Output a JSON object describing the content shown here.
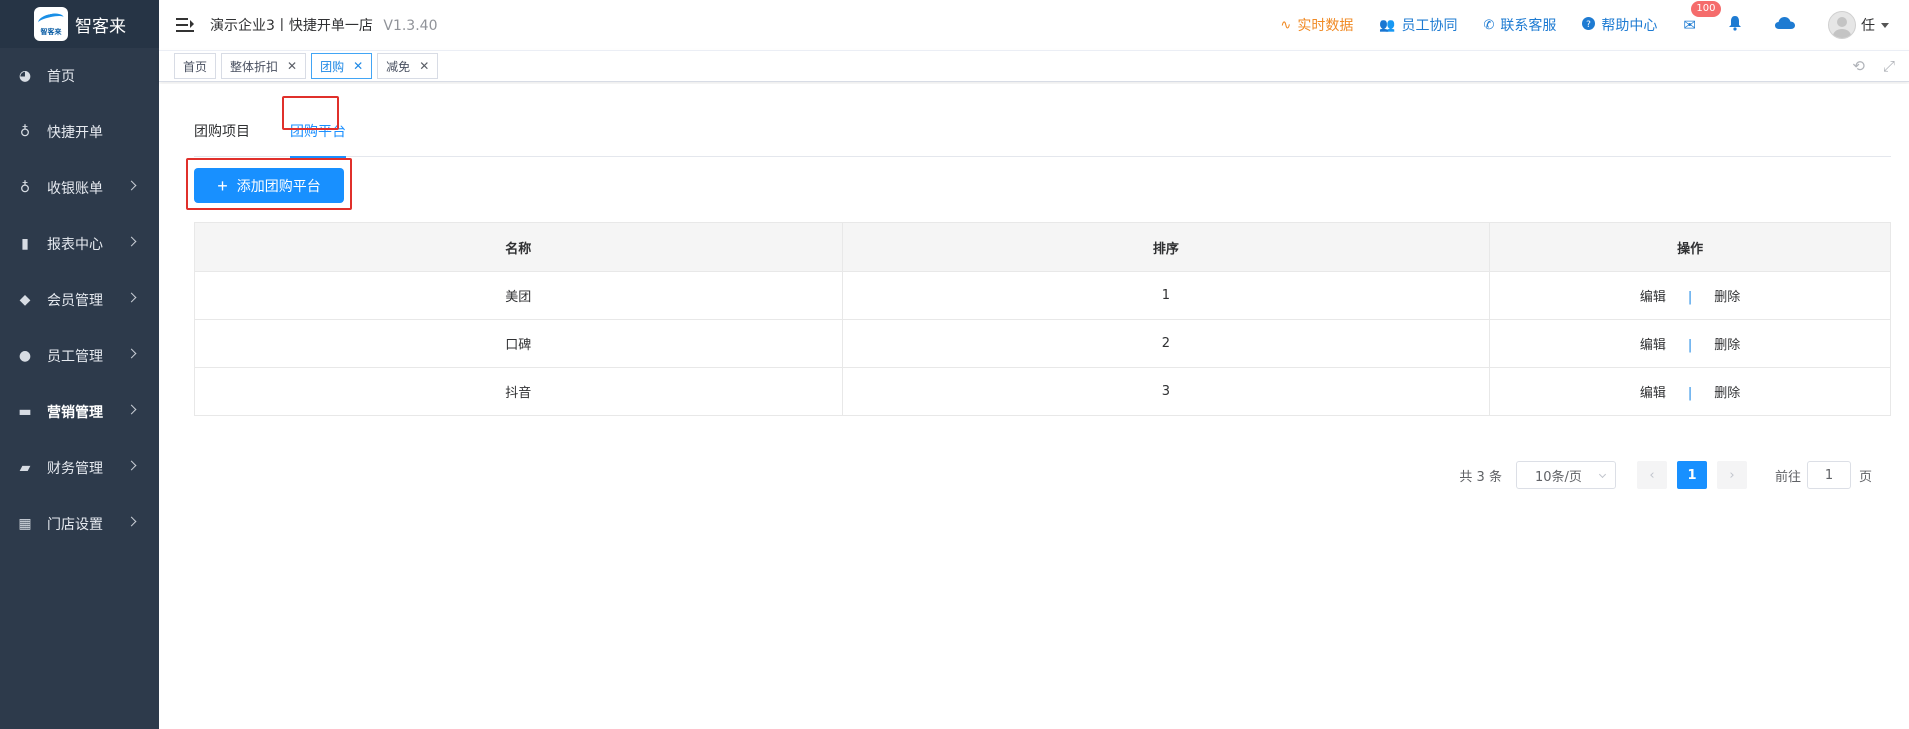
{
  "brand": {
    "logo_text": "智客来",
    "name": "智客来"
  },
  "sidebar": {
    "items": [
      {
        "label": "首页",
        "icon": "dashboard-icon",
        "has_arrow": false
      },
      {
        "label": "快捷开单",
        "icon": "money-bag-icon",
        "has_arrow": false
      },
      {
        "label": "收银账单",
        "icon": "money-bag-icon",
        "has_arrow": true
      },
      {
        "label": "报表中心",
        "icon": "bar-chart-icon",
        "has_arrow": true
      },
      {
        "label": "会员管理",
        "icon": "diamond-icon",
        "has_arrow": true
      },
      {
        "label": "员工管理",
        "icon": "user-icon",
        "has_arrow": true
      },
      {
        "label": "营销管理",
        "icon": "briefcase-icon",
        "has_arrow": true,
        "active": true
      },
      {
        "label": "财务管理",
        "icon": "wallet-icon",
        "has_arrow": true
      },
      {
        "label": "门店设置",
        "icon": "grid-icon",
        "has_arrow": true
      }
    ]
  },
  "header": {
    "breadcrumb": "演示企业3丨快捷开单一店",
    "version": "V1.3.40",
    "links": [
      {
        "label": "实时数据",
        "icon": "pulse-icon",
        "color": "#f08a24"
      },
      {
        "label": "员工协同",
        "icon": "users-icon",
        "color": "#1e7bd2"
      },
      {
        "label": "联系客服",
        "icon": "phone-icon",
        "color": "#1e7bd2"
      },
      {
        "label": "帮助中心",
        "icon": "question-icon",
        "color": "#1e7bd2"
      }
    ],
    "mail_badge": "100",
    "user_name": "任"
  },
  "tags": [
    {
      "label": "首页",
      "closable": false,
      "active": false
    },
    {
      "label": "整体折扣",
      "closable": true,
      "active": false
    },
    {
      "label": "团购",
      "closable": true,
      "active": true
    },
    {
      "label": "减免",
      "closable": true,
      "active": false
    }
  ],
  "main": {
    "tabs": [
      {
        "label": "团购项目",
        "active": false
      },
      {
        "label": "团购平台",
        "active": true
      }
    ],
    "add_button": "添加团购平台",
    "table": {
      "columns": [
        "名称",
        "排序",
        "操作"
      ],
      "rows": [
        {
          "name": "美团",
          "sort": "1"
        },
        {
          "name": "口碑",
          "sort": "2"
        },
        {
          "name": "抖音",
          "sort": "3"
        }
      ],
      "edit_label": "编辑",
      "delete_label": "删除"
    },
    "pagination": {
      "total": "共 3 条",
      "page_size": "10条/页",
      "current": "1",
      "goto_label": "前往",
      "goto_value": "1",
      "page_suffix": "页"
    }
  },
  "colors": {
    "accent": "#1890ff",
    "sidebar_bg": "#2d3a4b",
    "highlight": "#e0302b",
    "orange": "#f08a24"
  }
}
